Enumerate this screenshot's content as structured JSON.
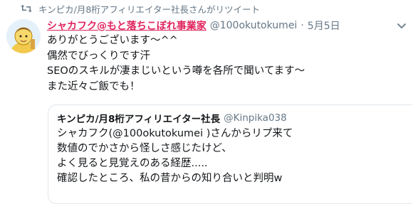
{
  "retweet": {
    "text": "キンピカ/月8桁アフィリエイター社長さんがリツイート",
    "icon": "retweet-icon"
  },
  "tweet": {
    "display_name": "シャカフク@もと落ちこぼれ事業家",
    "handle": "@100okutokumei",
    "separator": "·",
    "time": "5月5日",
    "body": "ありがとうございます〜^^\n偶然でびっくりです汗\nSEOのスキルが凄まじいという噂を各所で聞いてます〜\nまた近々ご飯でも！",
    "name_color": "#e0245e"
  },
  "quoted": {
    "display_name": "キンピカ/月8桁アフィリエイター社長",
    "handle": "@Kinpika038",
    "body": "シャカフク(@100okutokumei )さんからリプ来て\n数値のでかさから怪しさ感じたけど、\nよく見ると見覚えのある経歴.....\n確認したところ、私の昔からの知り合いと判明w"
  }
}
